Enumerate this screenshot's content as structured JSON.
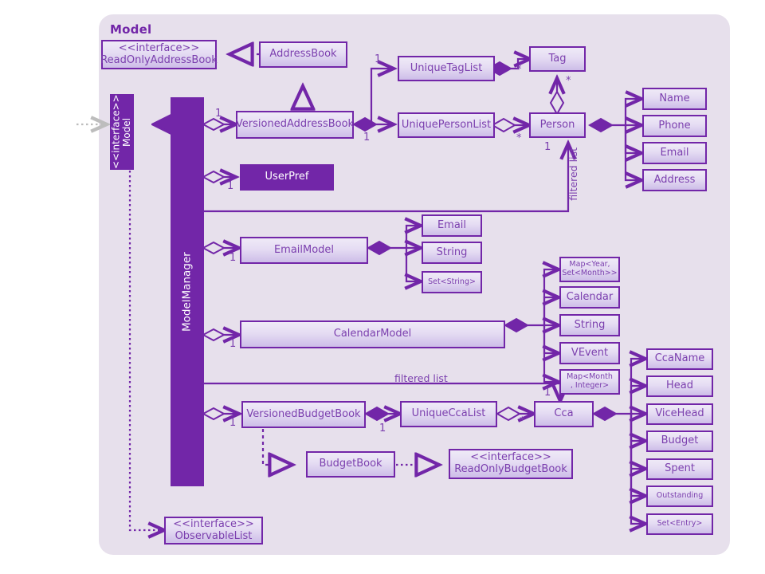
{
  "diagram": {
    "title": "Model",
    "type": "uml-class-diagram",
    "palette": {
      "page_background": "#ffffff",
      "panel_background": "#e7e0ec",
      "stroke": "#7226a8",
      "text": "#7b3fae",
      "solid_fill": "#7226a8",
      "solid_text": "#ffffff",
      "external_arrow": "#bdbdbd"
    }
  },
  "nodes": {
    "read_only_address_book": {
      "label": "<<interface>>\nReadOnlyAddressBook",
      "style": "gradient"
    },
    "address_book": {
      "label": "AddressBook",
      "style": "gradient"
    },
    "model_interface": {
      "label": "<<interface>>\nModel",
      "style": "solid",
      "orientation": "vertical"
    },
    "model_manager": {
      "label": "ModelManager",
      "style": "solid",
      "orientation": "vertical"
    },
    "versioned_address_book": {
      "label": "VersionedAddressBook",
      "style": "gradient"
    },
    "unique_tag_list": {
      "label": "UniqueTagList",
      "style": "gradient"
    },
    "tag": {
      "label": "Tag",
      "style": "gradient"
    },
    "unique_person_list": {
      "label": "UniquePersonList",
      "style": "gradient"
    },
    "person": {
      "label": "Person",
      "style": "gradient"
    },
    "name": {
      "label": "Name",
      "style": "gradient"
    },
    "phone": {
      "label": "Phone",
      "style": "gradient"
    },
    "email_attr": {
      "label": "Email",
      "style": "gradient"
    },
    "address": {
      "label": "Address",
      "style": "gradient"
    },
    "user_pref": {
      "label": "UserPref",
      "style": "solid"
    },
    "email_model": {
      "label": "EmailModel",
      "style": "gradient"
    },
    "email_type": {
      "label": "Email",
      "style": "gradient"
    },
    "string_type": {
      "label": "String",
      "style": "gradient"
    },
    "set_string": {
      "label": "Set<String>",
      "style": "gradient",
      "size": "small"
    },
    "calendar_model": {
      "label": "CalendarModel",
      "style": "gradient"
    },
    "map_year_set_month": {
      "label": "Map<Year,\nSet<Month>>",
      "style": "gradient",
      "size": "small"
    },
    "calendar": {
      "label": "Calendar",
      "style": "gradient"
    },
    "string_type_2": {
      "label": "String",
      "style": "gradient"
    },
    "vevent": {
      "label": "VEvent",
      "style": "gradient"
    },
    "map_month_integer": {
      "label": "Map<Month\n, Integer>",
      "style": "gradient",
      "size": "small"
    },
    "versioned_budget_book": {
      "label": "VersionedBudgetBook",
      "style": "gradient"
    },
    "unique_cca_list": {
      "label": "UniqueCcaList",
      "style": "gradient"
    },
    "cca": {
      "label": "Cca",
      "style": "gradient"
    },
    "budget_book": {
      "label": "BudgetBook",
      "style": "gradient"
    },
    "read_only_budget_book": {
      "label": "<<interface>>\nReadOnlyBudgetBook",
      "style": "gradient"
    },
    "cca_name": {
      "label": "CcaName",
      "style": "gradient"
    },
    "head": {
      "label": "Head",
      "style": "gradient"
    },
    "vice_head": {
      "label": "ViceHead",
      "style": "gradient"
    },
    "budget": {
      "label": "Budget",
      "style": "gradient"
    },
    "spent": {
      "label": "Spent",
      "style": "gradient"
    },
    "outstanding": {
      "label": "Outstanding",
      "style": "gradient",
      "size": "small"
    },
    "set_entry": {
      "label": "Set<Entry>",
      "style": "gradient",
      "size": "small"
    },
    "observable_list": {
      "label": "<<interface>>\nObservableList",
      "style": "gradient"
    }
  },
  "multiplicities": {
    "vab_model": "1",
    "vab_tag_list": "1",
    "vab_person_list": "1",
    "tag_star": "*",
    "tag_person_star": "*",
    "person_star": "*",
    "person_filtered": "1",
    "user_pref": "1",
    "email_model": "1",
    "calendar_model": "1",
    "versioned_budget_book": "1",
    "unique_cca_list": "1",
    "cca_star": "*",
    "cca_filtered": "1"
  },
  "edge_labels": {
    "filtered_list_person": "filtered list",
    "filtered_list_cca": "filtered list"
  }
}
